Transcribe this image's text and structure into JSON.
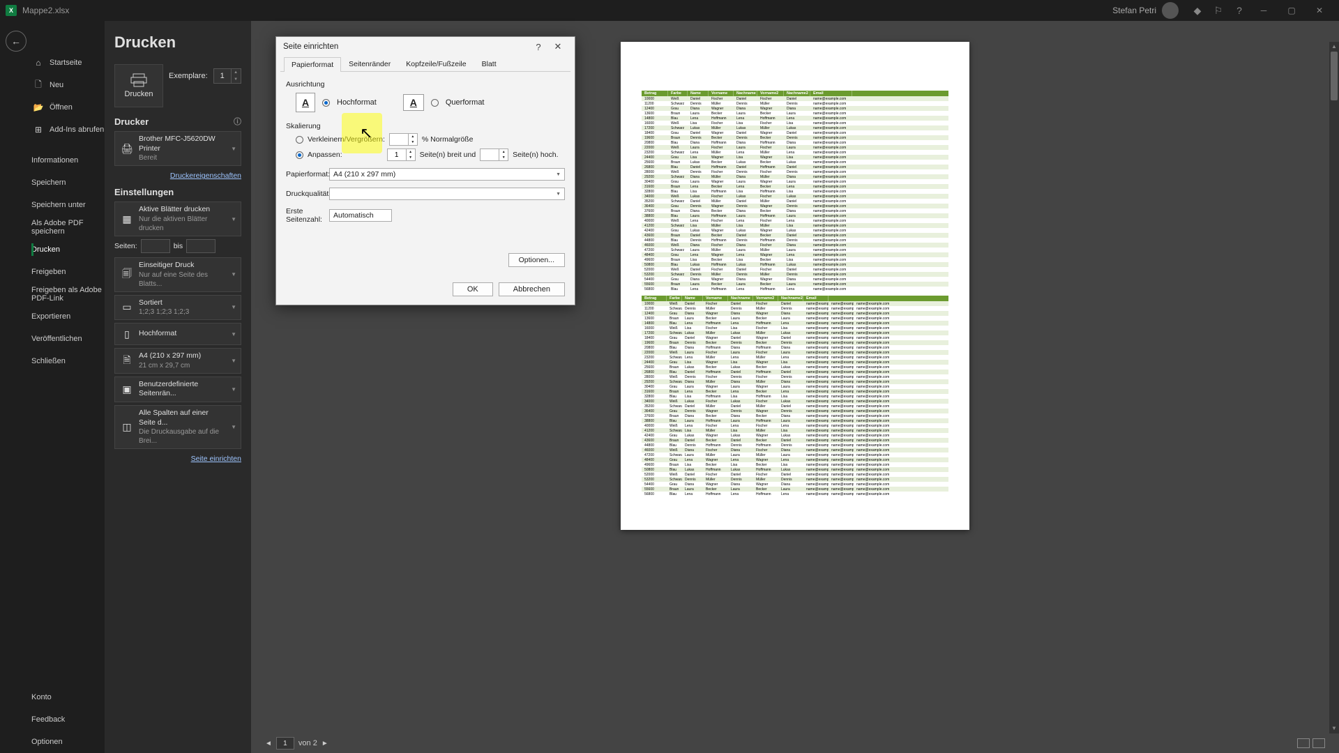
{
  "titlebar": {
    "app": "X",
    "filename": "Mappe2.xlsx",
    "username": "Stefan Petri"
  },
  "nav": {
    "top": [
      {
        "icon": "⌂",
        "label": "Startseite"
      },
      {
        "icon": "🗋",
        "label": "Neu"
      },
      {
        "icon": "📂",
        "label": "Öffnen"
      },
      {
        "icon": "⊞",
        "label": "Add-Ins abrufen"
      }
    ],
    "mid": [
      "Informationen",
      "Speichern",
      "Speichern unter",
      "Als Adobe PDF speichern",
      "Drucken",
      "Freigeben",
      "Freigeben als Adobe PDF-Link",
      "Exportieren",
      "Veröffentlichen",
      "Schließen"
    ],
    "active": "Drucken",
    "bottom": [
      "Konto",
      "Feedback",
      "Optionen"
    ]
  },
  "print": {
    "title": "Drucken",
    "button": "Drucken",
    "copies_label": "Exemplare:",
    "copies": "1",
    "printer_hdr": "Drucker",
    "printer_name": "Brother MFC-J5620DW Printer",
    "printer_status": "Bereit",
    "printer_props": "Druckereigenschaften",
    "settings_hdr": "Einstellungen",
    "settings": [
      {
        "icon": "▦",
        "l1": "Aktive Blätter drucken",
        "l2": "Nur die aktiven Blätter drucken"
      },
      {
        "icon": "🗐",
        "l1": "Einseitiger Druck",
        "l2": "Nur auf eine Seite des Blatts..."
      },
      {
        "icon": "▭",
        "l1": "Sortiert",
        "l2": "1;2;3    1;2;3    1;2;3"
      },
      {
        "icon": "▯",
        "l1": "Hochformat",
        "l2": ""
      },
      {
        "icon": "🗎",
        "l1": "A4 (210 x 297 mm)",
        "l2": "21 cm x 29,7 cm"
      },
      {
        "icon": "▣",
        "l1": "Benutzerdefinierte Seitenrän...",
        "l2": ""
      },
      {
        "icon": "◫",
        "l1": "Alle Spalten auf einer Seite d...",
        "l2": "Die Druckausgabe auf die Brei..."
      }
    ],
    "pages_label": "Seiten:",
    "pages_to": "bis",
    "page_setup": "Seite einrichten"
  },
  "dialog": {
    "title": "Seite einrichten",
    "tabs": [
      "Papierformat",
      "Seitenränder",
      "Kopfzeile/Fußzeile",
      "Blatt"
    ],
    "active_tab": 0,
    "orientation_label": "Ausrichtung",
    "portrait": "Hochformat",
    "landscape": "Querformat",
    "scaling_label": "Skalierung",
    "scale_radio1": "Verkleinern/Vergrößern:",
    "scale_pct_suffix": "% Normalgröße",
    "scale_radio2": "Anpassen:",
    "fit_wide": "1",
    "fit_wide_label": "Seite(n) breit und",
    "fit_tall": "",
    "fit_tall_label": "Seite(n) hoch.",
    "paper_label": "Papierformat:",
    "paper_value": "A4 (210 x 297 mm)",
    "quality_label": "Druckqualität:",
    "quality_value": "",
    "firstpage_label": "Erste Seitenzahl:",
    "firstpage_value": "Automatisch",
    "options_btn": "Optionen...",
    "ok": "OK",
    "cancel": "Abbrechen"
  },
  "preview": {
    "headers": [
      "Betrag",
      "Farbe",
      "Name",
      "Vorname",
      "Nachname",
      "Vorname2",
      "Nachname2",
      "Email"
    ],
    "page_current": "1",
    "page_label": "von 2"
  }
}
